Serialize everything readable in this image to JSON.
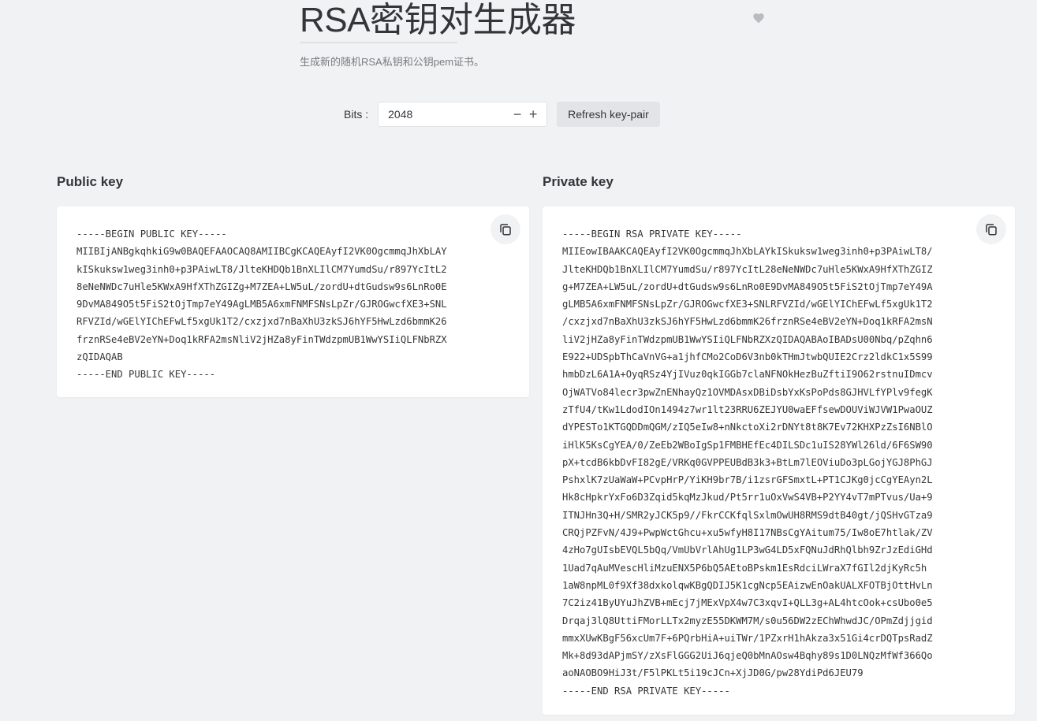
{
  "header": {
    "title": "RSA密钥对生成器",
    "subtitle": "生成新的随机RSA私钥和公钥pem证书。",
    "favorite_icon": "heart-icon"
  },
  "controls": {
    "bits_label": "Bits :",
    "bits_value": "2048",
    "decrement_symbol": "−",
    "increment_symbol": "+",
    "refresh_label": "Refresh key-pair"
  },
  "public_key": {
    "heading": "Public key",
    "copy_icon": "copy-icon",
    "text": "-----BEGIN PUBLIC KEY-----\nMIIBIjANBgkqhkiG9w0BAQEFAAOCAQ8AMIIBCgKCAQEAyfI2VK0OgcmmqJhXbLAY\nkISkuksw1weg3inh0+p3PAiwLT8/JlteKHDQb1BnXLIlCM7YumdSu/r897YcItL2\n8eNeNWDc7uHle5KWxA9HfXThZGIZg+M7ZEA+LW5uL/zordU+dtGudsw9s6LnRo0E\n9DvMA849O5t5FiS2tOjTmp7eY49AgLMB5A6xmFNMFSNsLpZr/GJROGwcfXE3+SNL\nRFVZId/wGElYIChEFwLf5xgUk1T2/cxzjxd7nBaXhU3zkSJ6hYF5HwLzd6bmmK26\nfrznRSe4eBV2eYN+Doq1kRFA2msNliV2jHZa8yFinTWdzpmUB1WwYSIiQLFNbRZX\nzQIDAQAB\n-----END PUBLIC KEY-----"
  },
  "private_key": {
    "heading": "Private key",
    "copy_icon": "copy-icon",
    "text": "-----BEGIN RSA PRIVATE KEY-----\nMIIEowIBAAKCAQEAyfI2VK0OgcmmqJhXbLAYkISkuksw1weg3inh0+p3PAiwLT8/\nJlteKHDQb1BnXLIlCM7YumdSu/r897YcItL28eNeNWDc7uHle5KWxA9HfXThZGIZ\ng+M7ZEA+LW5uL/zordU+dtGudsw9s6LnRo0E9DvMA849O5t5FiS2tOjTmp7eY49A\ngLMB5A6xmFNMFSNsLpZr/GJROGwcfXE3+SNLRFVZId/wGElYIChEFwLf5xgUk1T2\n/cxzjxd7nBaXhU3zkSJ6hYF5HwLzd6bmmK26frznRSe4eBV2eYN+Doq1kRFA2msN\nliV2jHZa8yFinTWdzpmUB1WwYSIiQLFNbRZXzQIDAQABAoIBADsU00Nbq/pZqhn6\nE922+UDSpbThCaVnVG+a1jhfCMo2CoD6V3nb0kTHmJtwbQUIE2Crz2ldkC1x5S99\nhmbDzL6A1A+OyqRSz4YjIVuz0qkIGGb7claNFNOkHezBuZftiI9O62rstnuIDmcv\nOjWATVo84lecr3pwZnENhayQz1OVMDAsxDBiDsbYxKsPoPds8GJHVLfYPlv9fegK\nzTfU4/tKw1LdodIOn1494z7wr1lt23RRU6ZEJYU0waEFfsewDOUViWJVW1PwaOUZ\ndYPESTo1KTGQDDmQGM/zIQ5eIw8+nNkctoXi2rDNYt8t8K7Ev72KHXPzZsI6NBlO\niHlK5KsCgYEA/0/ZeEb2WBoIgSp1FMBHEfEc4DILSDc1uIS28YWl26ld/6F6SW90\npX+tcdB6kbDvFI82gE/VRKq0GVPPEUBdB3k3+BtLm7lEOViuDo3pLGojYGJ8PhGJ\nPshxlK7zUaWaW+PCvpHrP/YiKH9br7B/i1zsrGFSmxtL+PT1CJKg0jcCgYEAyn2L\nHk8cHpkrYxFo6D3Zqid5kqMzJkud/Pt5rr1uOxVwS4VB+P2YY4vT7mPTvus/Ua+9\nITNJHn3Q+H/SMR2yJCK5p9//FkrCCKfqlSxlmOwUH8RMS9dtB40gt/jQSHvGTza9\nCRQjPZFvN/4J9+PwpWctGhcu+xu5wfyH8I17NBsCgYAitum75/Iw8oE7htlak/ZV\n4zHo7gUIsbEVQL5bQq/VmUbVrlAhUg1LP3wG4LD5xFQNuJdRhQlbh9ZrJzEdiGHd\n1Uad7qAuMVescHliMzuENX5P6bQ5AEtoBPskm1EsRdciLWraX7fGIl2djKyRc5h\n1aW8npML0f9Xf38dxkolqwKBgQDIJ5K1cgNcp5EAizwEnOakUALXFOTBjOttHvLn\n7C2iz41ByUYuJhZVB+mEcj7jMExVpX4w7C3xqvI+QLL3g+AL4htcOok+csUbo0e5\nDrqaj3lQ8UttiFMorLLTx2myzE55DKWM7M/s0u56DW2zEChWhwdJC/OPmZdjjgid\nmmxXUwKBgF56xcUm7F+6PQrbHiA+uiTWr/1PZxrH1hAkza3x51Gi4crDQTpsRadZ\nMk+8d93dAPjmSY/zXsFlGGG2UiJ6qjeQ0bMnAOsw4Bqhy89s1D0LNQzMfWf366Qo\naoNAOBO9HiJ3t/F5lPKLt5i19cJCn+XjJD0G/pw28YdiPd6JEU79\n-----END RSA PRIVATE KEY-----"
  }
}
